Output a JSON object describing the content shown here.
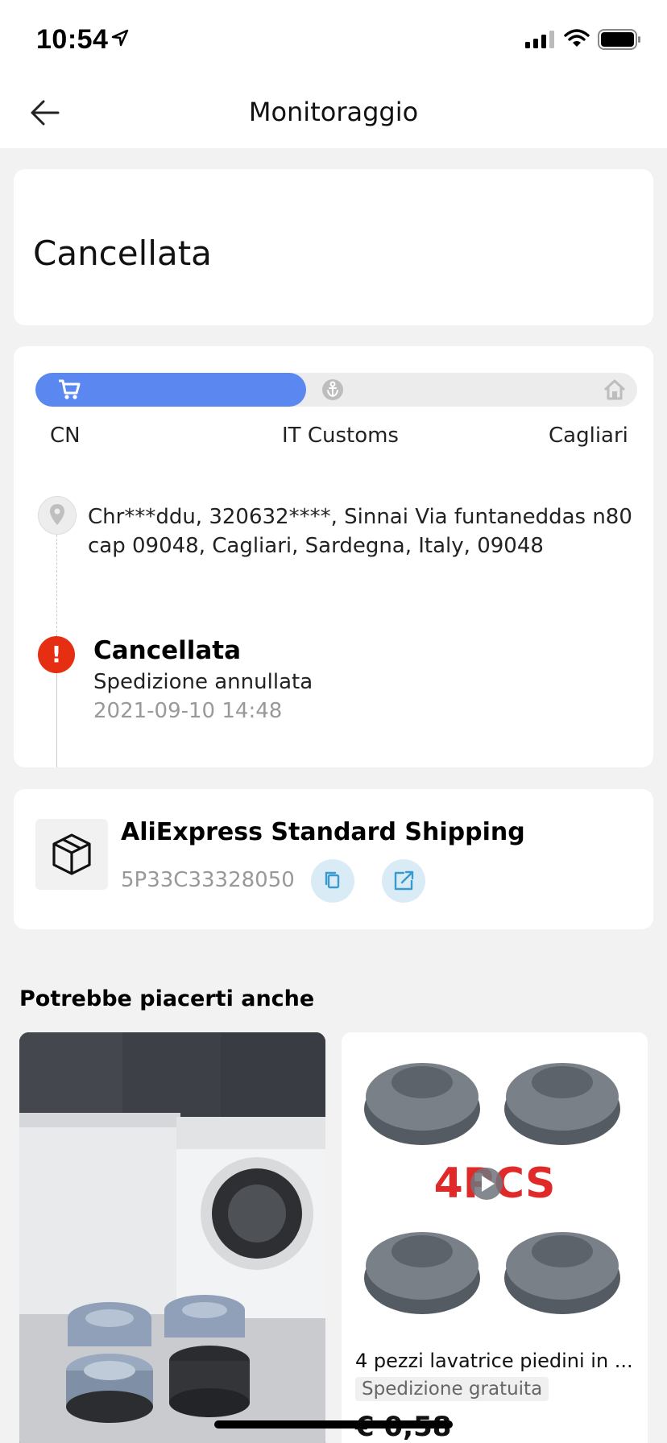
{
  "status_bar": {
    "time": "10:54"
  },
  "nav": {
    "title": "Monitoraggio"
  },
  "order_status": "Cancellata",
  "progress": {
    "fill_fraction": 0.45,
    "stages": [
      "CN",
      "IT Customs",
      "Cagliari"
    ],
    "active_color": "#5b88f0"
  },
  "address": "Chr***ddu, 320632****, Sinnai Via funtaneddas n80 cap 09048, Cagliari, Sardegna, Italy, 09048",
  "event": {
    "title": "Cancellata",
    "description": "Spedizione annullata",
    "time": "2021-09-10 14:48",
    "icon_color": "#e62e12"
  },
  "shipping": {
    "carrier": "AliExpress Standard Shipping",
    "tracking_number": "5P33C33328050"
  },
  "recommendations": {
    "title": "Potrebbe piacerti anche",
    "items": [
      {
        "image": "washing-machine-feet-photo"
      },
      {
        "image": "4pcs-rubber-feet-photo",
        "image_text": "4PCS",
        "name": "4 pezzi lavatrice piedini in ...",
        "shipping": "Spedizione gratuita",
        "price": "€ 0,58"
      }
    ]
  },
  "icons": [
    "location-arrow-icon",
    "signal-icon",
    "wifi-icon",
    "battery-icon",
    "back-arrow-icon",
    "cart-icon",
    "anchor-icon",
    "home-icon",
    "location-pin-icon",
    "alert-icon",
    "package-icon",
    "copy-icon",
    "external-link-icon",
    "play-icon"
  ]
}
